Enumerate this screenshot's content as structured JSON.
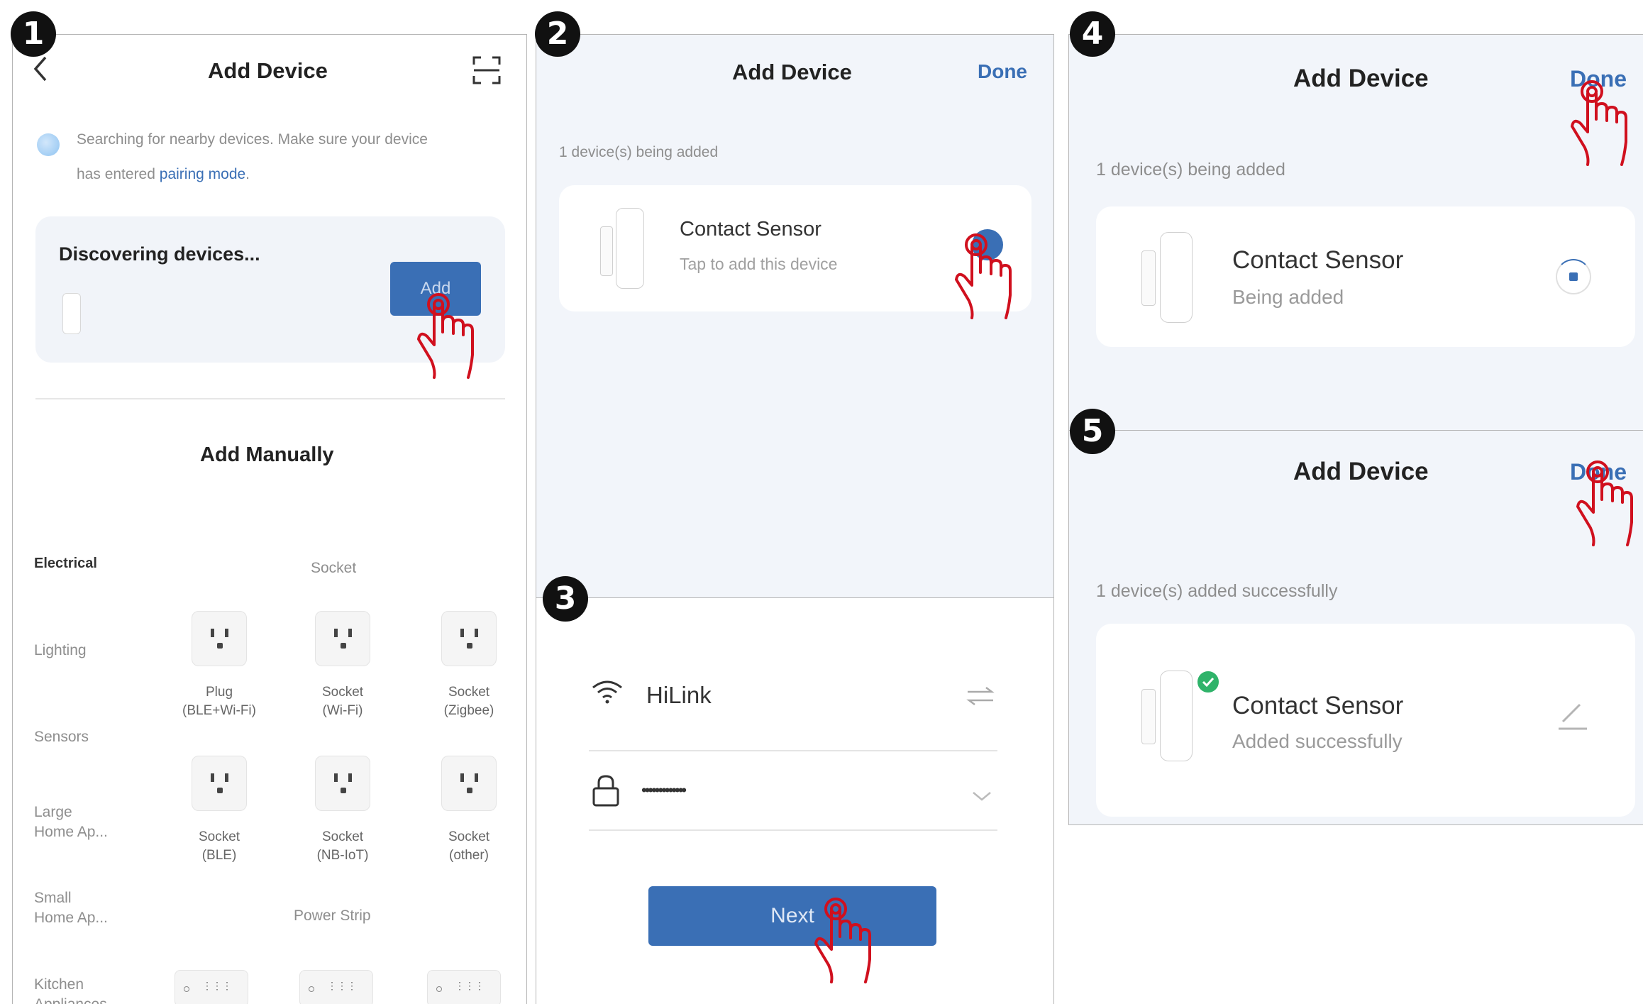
{
  "steps": [
    "1",
    "2",
    "3",
    "4",
    "5"
  ],
  "title": "Add Device",
  "done_label": "Done",
  "device_name": "Contact Sensor",
  "panel1": {
    "search_text_line1": "Searching for nearby devices. Make sure your device",
    "search_text_line2": "has entered ",
    "pairing_link": "pairing mode",
    "search_text_end": ".",
    "discovering": "Discovering devices...",
    "add_label": "Add",
    "add_manually": "Add Manually",
    "categories": [
      "Electrical",
      "Lighting",
      "Sensors",
      "Large\nHome Ap...",
      "Small\nHome Ap...",
      "Kitchen\nAppliances"
    ],
    "socket_header": "Socket",
    "power_strip_header": "Power Strip",
    "row1": [
      {
        "line1": "Plug",
        "line2": "(BLE+Wi-Fi)"
      },
      {
        "line1": "Socket",
        "line2": "(Wi-Fi)"
      },
      {
        "line1": "Socket",
        "line2": "(Zigbee)"
      }
    ],
    "row2": [
      {
        "line1": "Socket",
        "line2": "(BLE)"
      },
      {
        "line1": "Socket",
        "line2": "(NB-IoT)"
      },
      {
        "line1": "Socket",
        "line2": "(other)"
      }
    ]
  },
  "panel2": {
    "count_text": "1 device(s) being added",
    "device_sub": "Tap to add this device"
  },
  "panel3": {
    "wifi_name": "HiLink",
    "password_mask": "•••••••••••••",
    "next_label": "Next"
  },
  "panel4": {
    "count_text": "1 device(s) being added",
    "device_sub": "Being added"
  },
  "panel5": {
    "count_text": "1 device(s) added successfully",
    "device_sub": "Added successfully"
  },
  "colors": {
    "accent": "#3a6fb5",
    "pointer": "#d0101e",
    "panel_bg": "#f2f5fa",
    "success": "#2fb36a"
  },
  "icons": [
    "back-arrow-icon",
    "scan-icon",
    "bluetooth-dot-icon",
    "wifi-icon",
    "switch-network-icon",
    "lock-icon",
    "chevron-down-icon",
    "loading-icon",
    "edit-icon",
    "check-icon",
    "socket-icon",
    "power-strip-icon",
    "pointer-hand-icon"
  ]
}
